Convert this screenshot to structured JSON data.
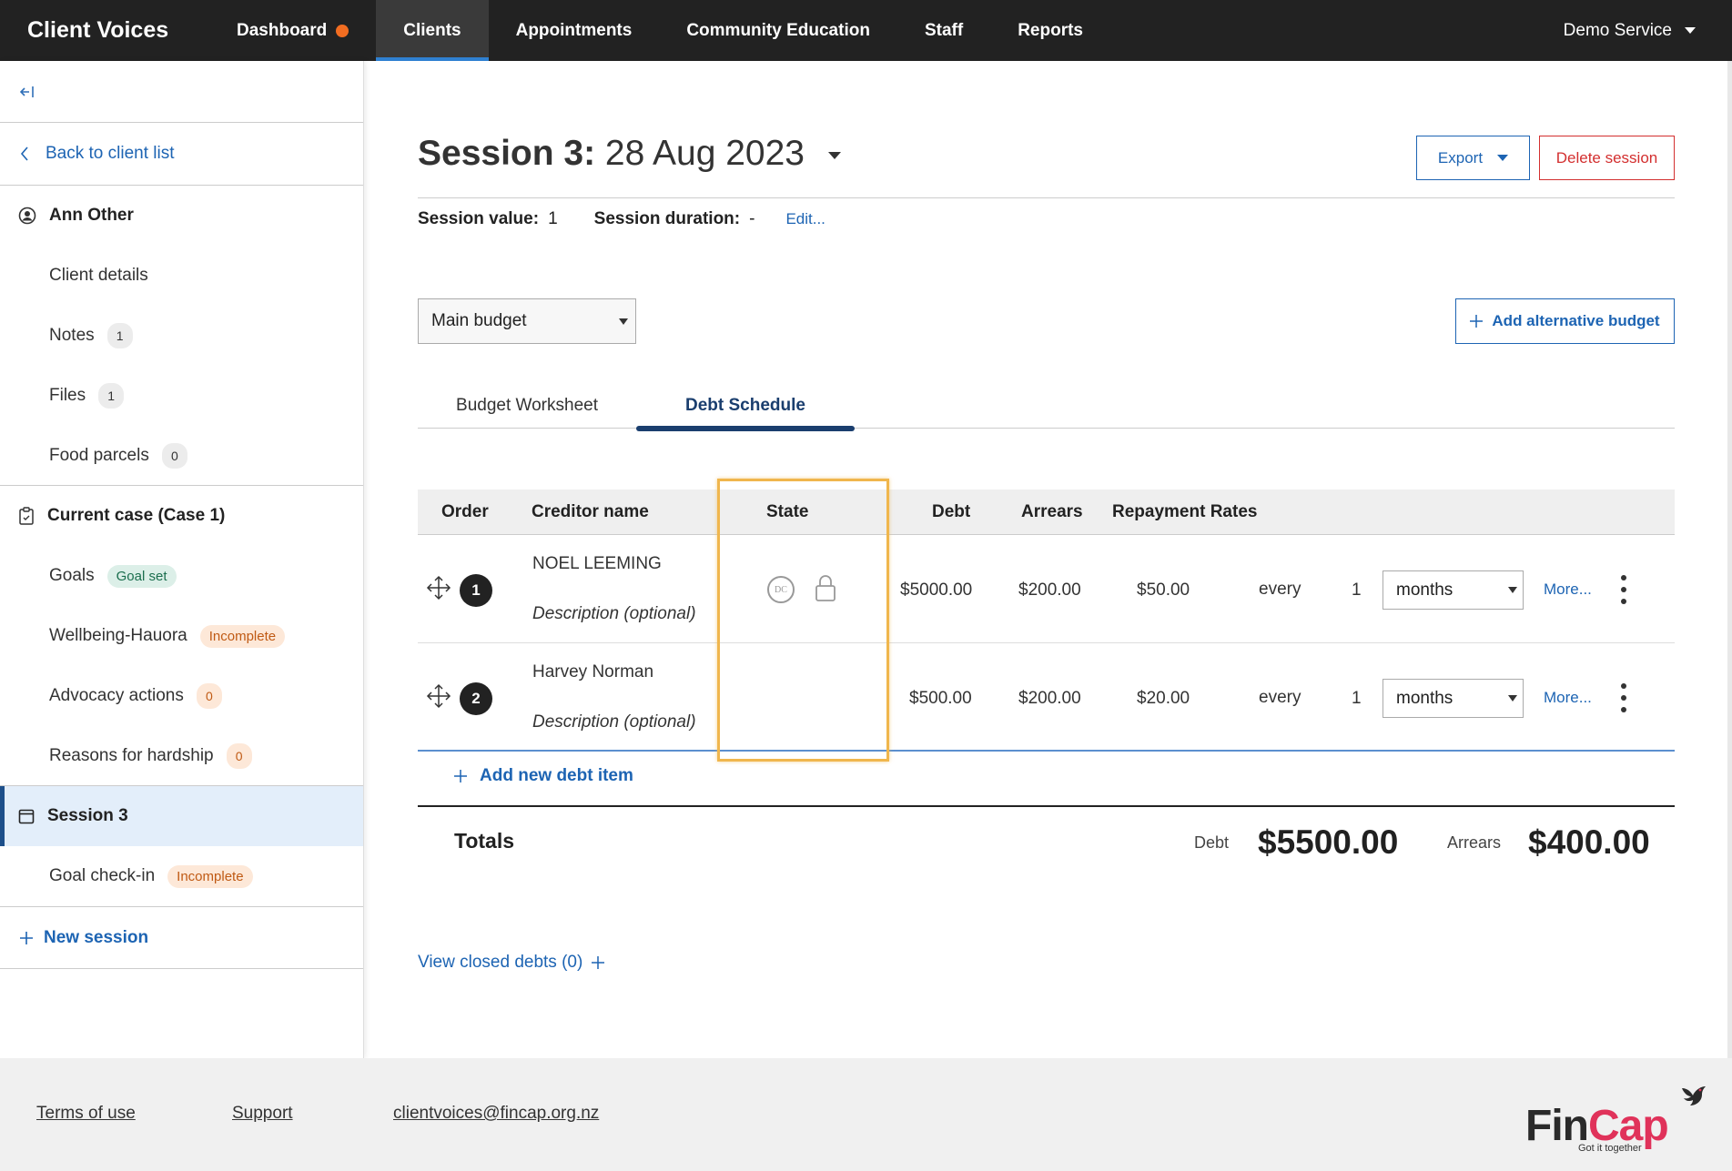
{
  "app": {
    "title": "Client Voices"
  },
  "nav": {
    "items": [
      "Dashboard",
      "Clients",
      "Appointments",
      "Community Education",
      "Staff",
      "Reports"
    ],
    "active": "Clients",
    "service": "Demo Service"
  },
  "sidebar": {
    "back": "Back to client list",
    "client_name": "Ann Other",
    "client_items": [
      {
        "label": "Client details"
      },
      {
        "label": "Notes",
        "count": "1"
      },
      {
        "label": "Files",
        "count": "1"
      },
      {
        "label": "Food parcels",
        "count": "0"
      }
    ],
    "case_title": "Current case (Case 1)",
    "case_items": [
      {
        "label": "Goals",
        "status": "Goal set"
      },
      {
        "label": "Wellbeing-Hauora",
        "status": "Incomplete"
      },
      {
        "label": "Advocacy actions",
        "count": "0"
      },
      {
        "label": "Reasons for hardship",
        "count": "0"
      }
    ],
    "session_title": "Session 3",
    "session_items": [
      {
        "label": "Goal check-in",
        "status": "Incomplete"
      }
    ],
    "new_session": "New session"
  },
  "session": {
    "title_bold": "Session 3:",
    "title_date": "28 Aug 2023",
    "export": "Export",
    "delete": "Delete session",
    "value_label": "Session value:",
    "value": "1",
    "duration_label": "Session duration:",
    "duration": "-",
    "edit": "Edit..."
  },
  "budget": {
    "selected": "Main budget",
    "add_alt": "Add alternative budget"
  },
  "tabs": [
    "Budget Worksheet",
    "Debt Schedule"
  ],
  "table": {
    "headers": [
      "Order",
      "Creditor name",
      "State",
      "Debt",
      "Arrears",
      "Repayment Rates"
    ],
    "rows": [
      {
        "order": "1",
        "creditor": "NOEL LEEMING",
        "description": "Description (optional)",
        "state_dc": "DC",
        "debt": "$5000.00",
        "arrears": "$200.00",
        "rate": "$50.00",
        "every": "every",
        "count": "1",
        "period": "months",
        "more": "More..."
      },
      {
        "order": "2",
        "creditor": "Harvey Norman",
        "description": "Description (optional)",
        "debt": "$500.00",
        "arrears": "$200.00",
        "rate": "$20.00",
        "every": "every",
        "count": "1",
        "period": "months",
        "more": "More..."
      }
    ],
    "add_debt": "Add new debt item"
  },
  "totals": {
    "label": "Totals",
    "debt_label": "Debt",
    "debt": "$5500.00",
    "arrears_label": "Arrears",
    "arrears": "$400.00"
  },
  "closed_debts": "View closed debts (0)",
  "footer": {
    "terms": "Terms of use",
    "support": "Support",
    "email": "clientvoices@fincap.org.nz",
    "logo_fin": "Fin",
    "logo_cap": "Cap",
    "logo_tagline": "Got it together"
  },
  "colors": {
    "nav_bg": "#222222",
    "link": "#1d64b3",
    "danger": "#d32f2f",
    "highlight": "#f0b64d",
    "brand_pink": "#e0325a"
  }
}
